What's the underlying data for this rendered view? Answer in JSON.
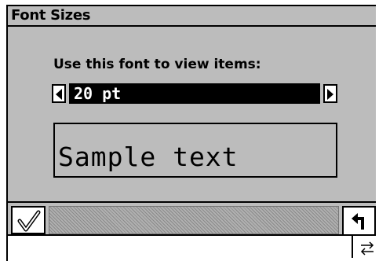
{
  "dialog": {
    "title": "Font Sizes",
    "prompt": "Use this font to view items:",
    "font_size_value": "20 pt",
    "sample_text": "Sample text"
  },
  "icons": {
    "left_arrow": "triangle-left-icon",
    "right_arrow": "triangle-right-icon",
    "ok": "checkmark-icon",
    "back": "return-arrow-icon",
    "switch": "swap-arrows-icon"
  }
}
